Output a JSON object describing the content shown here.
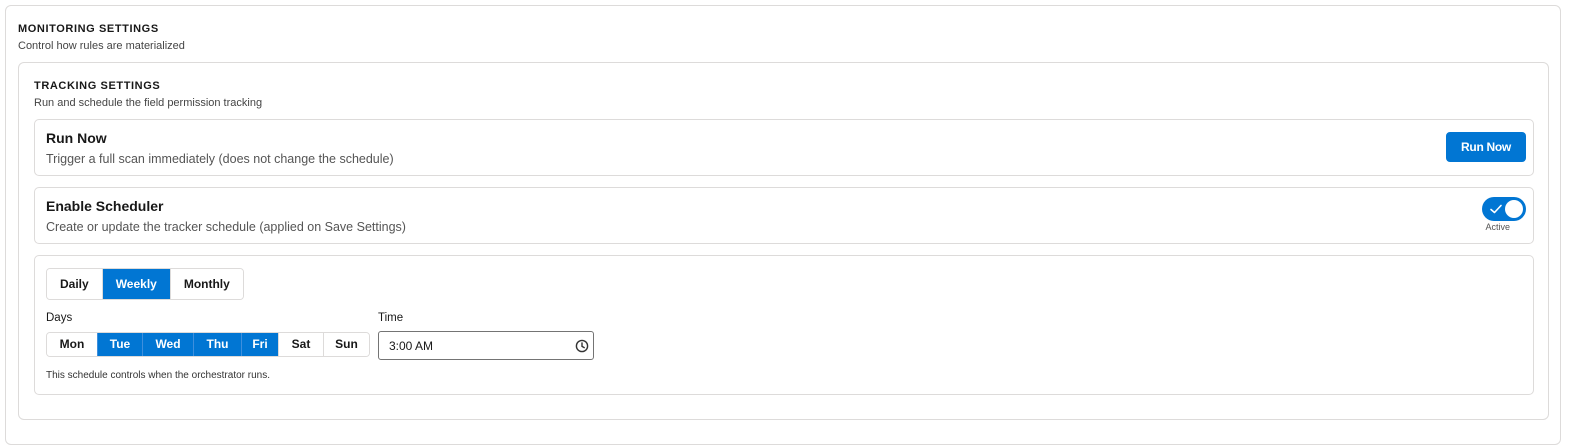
{
  "monitoring": {
    "title": "MONITORING SETTINGS",
    "subtitle": "Control how rules are materialized"
  },
  "tracking": {
    "title": "TRACKING SETTINGS",
    "subtitle": "Run and schedule the field permission tracking"
  },
  "run_now": {
    "title": "Run Now",
    "description": "Trigger a full scan immediately (does not change the schedule)",
    "button_label": "Run Now"
  },
  "scheduler": {
    "title": "Enable Scheduler",
    "description": "Create or update the tracker schedule (applied on Save Settings)",
    "toggle_state": "on",
    "toggle_label": "Active",
    "toggle_icon": "check-icon"
  },
  "frequency": {
    "options": [
      "Daily",
      "Weekly",
      "Monthly"
    ],
    "selected": "Weekly"
  },
  "days": {
    "label": "Days",
    "options": [
      "Mon",
      "Tue",
      "Wed",
      "Thu",
      "Fri",
      "Sat",
      "Sun"
    ],
    "selected": [
      "Tue",
      "Wed",
      "Thu",
      "Fri"
    ]
  },
  "time": {
    "label": "Time",
    "value": "3:00 AM",
    "icon": "clock-icon"
  },
  "note": "This schedule controls when the orchestrator runs.",
  "colors": {
    "accent": "#0176d3",
    "border": "#dddbda"
  }
}
